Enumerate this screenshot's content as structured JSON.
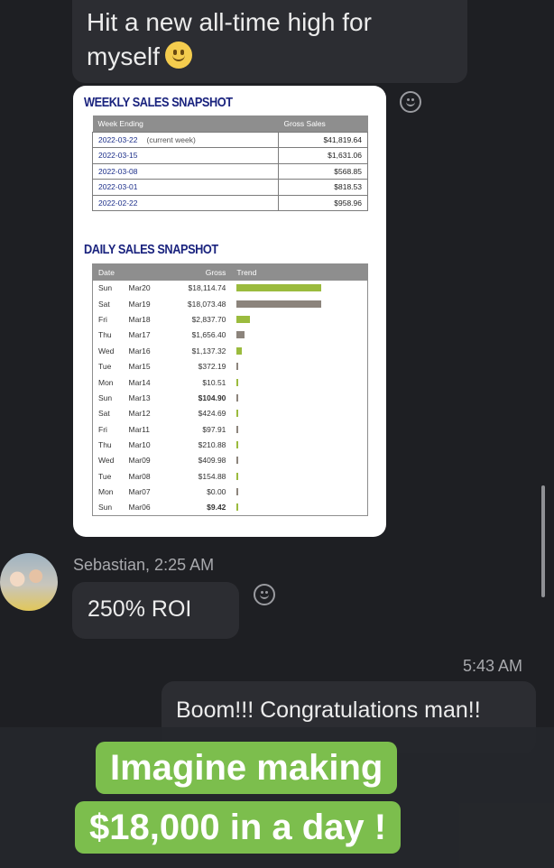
{
  "messages": {
    "top": {
      "text": "Hit a new all-time high for myself"
    },
    "sender": {
      "name_time": "Sebastian, 2:25 AM"
    },
    "roi": {
      "text": "250% ROI"
    },
    "reply": {
      "time": "5:43 AM",
      "text": "Boom!!! Congratulations man!!"
    }
  },
  "report": {
    "weekly": {
      "title": "WEEKLY SALES SNAPSHOT",
      "headers": [
        "Week Ending",
        "Gross Sales"
      ],
      "rows": [
        {
          "week": "2022-03-22",
          "note": "(current week)",
          "gross": "$41,819.64"
        },
        {
          "week": "2022-03-15",
          "note": "",
          "gross": "$1,631.06"
        },
        {
          "week": "2022-03-08",
          "note": "",
          "gross": "$568.85"
        },
        {
          "week": "2022-03-01",
          "note": "",
          "gross": "$818.53"
        },
        {
          "week": "2022-02-22",
          "note": "",
          "gross": "$958.96"
        }
      ]
    },
    "daily": {
      "title": "DAILY SALES SNAPSHOT",
      "headers": [
        "Date",
        "Gross",
        "Trend"
      ],
      "rows": [
        {
          "day": "Sun",
          "date": "Mar20",
          "gross": "$18,114.74",
          "value": 18114.74,
          "color": "#9bbb3e",
          "bold": false
        },
        {
          "day": "Sat",
          "date": "Mar19",
          "gross": "$18,073.48",
          "value": 18073.48,
          "color": "#8c847c",
          "bold": false
        },
        {
          "day": "Fri",
          "date": "Mar18",
          "gross": "$2,837.70",
          "value": 2837.7,
          "color": "#9bbb3e",
          "bold": false
        },
        {
          "day": "Thu",
          "date": "Mar17",
          "gross": "$1,656.40",
          "value": 1656.4,
          "color": "#8c847c",
          "bold": false
        },
        {
          "day": "Wed",
          "date": "Mar16",
          "gross": "$1,137.32",
          "value": 1137.32,
          "color": "#9bbb3e",
          "bold": false
        },
        {
          "day": "Tue",
          "date": "Mar15",
          "gross": "$372.19",
          "value": 372.19,
          "color": "#8c847c",
          "bold": false
        },
        {
          "day": "Mon",
          "date": "Mar14",
          "gross": "$10.51",
          "value": 10.51,
          "color": "#9bbb3e",
          "bold": false
        },
        {
          "day": "Sun",
          "date": "Mar13",
          "gross": "$104.90",
          "value": 104.9,
          "color": "#8c847c",
          "bold": true
        },
        {
          "day": "Sat",
          "date": "Mar12",
          "gross": "$424.69",
          "value": 424.69,
          "color": "#9bbb3e",
          "bold": false
        },
        {
          "day": "Fri",
          "date": "Mar11",
          "gross": "$97.91",
          "value": 97.91,
          "color": "#8c847c",
          "bold": false
        },
        {
          "day": "Thu",
          "date": "Mar10",
          "gross": "$210.88",
          "value": 210.88,
          "color": "#9bbb3e",
          "bold": false
        },
        {
          "day": "Wed",
          "date": "Mar09",
          "gross": "$409.98",
          "value": 409.98,
          "color": "#8c847c",
          "bold": false
        },
        {
          "day": "Tue",
          "date": "Mar08",
          "gross": "$154.88",
          "value": 154.88,
          "color": "#9bbb3e",
          "bold": false
        },
        {
          "day": "Mon",
          "date": "Mar07",
          "gross": "$0.00",
          "value": 0,
          "color": "#8c847c",
          "bold": false
        },
        {
          "day": "Sun",
          "date": "Mar06",
          "gross": "$9.42",
          "value": 9.42,
          "color": "#9bbb3e",
          "bold": true
        }
      ]
    }
  },
  "captions": {
    "line1": "Imagine making",
    "line2": "$18,000 in a day !"
  },
  "icons": {
    "emoji": "smiley-emoji",
    "reaction": "add-reaction-icon",
    "avatar": "user-avatar"
  },
  "colors": {
    "background": "#1e1f23",
    "bubble": "#2c2d32",
    "caption": "#7cbe4d",
    "report_title": "#1a237e"
  }
}
